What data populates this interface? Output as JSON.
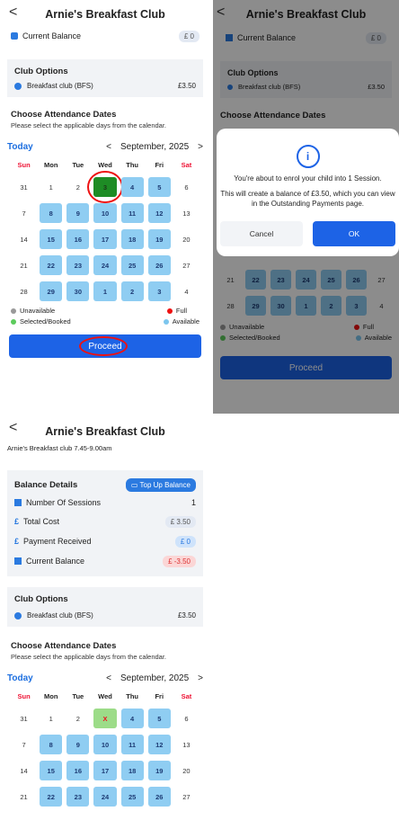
{
  "header": {
    "back_label": "<",
    "title": "Arnie's Breakfast Club"
  },
  "balance": {
    "current_label": "Current Balance",
    "current_value": "£ 0"
  },
  "club_options": {
    "title": "Club Options",
    "item": "Breakfast club (BFS)",
    "price": "£3.50"
  },
  "attendance": {
    "title": "Choose Attendance Dates",
    "hint": "Please select the applicable days from the calendar."
  },
  "calendar": {
    "today_label": "Today",
    "month": "September, 2025",
    "prev": "<",
    "next": ">",
    "days": [
      "Sun",
      "Mon",
      "Tue",
      "Wed",
      "Thu",
      "Fri",
      "Sat"
    ],
    "rows": [
      [
        "31",
        "1",
        "2",
        "3",
        "4",
        "5",
        "6"
      ],
      [
        "7",
        "8",
        "9",
        "10",
        "11",
        "12",
        "13"
      ],
      [
        "14",
        "15",
        "16",
        "17",
        "18",
        "19",
        "20"
      ],
      [
        "21",
        "22",
        "23",
        "24",
        "25",
        "26",
        "27"
      ],
      [
        "28",
        "29",
        "30",
        "1",
        "2",
        "3",
        "4"
      ]
    ]
  },
  "legend": {
    "unavailable": "Unavailable",
    "full": "Full",
    "selected": "Selected/Booked",
    "available": "Available"
  },
  "proceed_label": "Proceed",
  "modal": {
    "text1": "You're about to enrol your child into 1 Session.",
    "text2": "This will create a balance of £3.50, which you can view in the Outstanding Payments page.",
    "cancel": "Cancel",
    "ok": "OK"
  },
  "panel3": {
    "subtitle": "Arnie's Breakfast club 7.45-9.00am",
    "balance_title": "Balance Details",
    "topup": "Top Up Balance",
    "sessions_label": "Number Of Sessions",
    "sessions_value": "1",
    "total_label": "Total Cost",
    "total_value": "£ 3.50",
    "received_label": "Payment Received",
    "received_value": "£ 0",
    "current_label": "Current Balance",
    "current_value": "£ -3.50",
    "marked": "X"
  },
  "colors": {
    "accent": "#1d63e6",
    "available": "#8fcdf2",
    "selected": "#1e8c25",
    "full_bg": "#9cdc88",
    "full_text": "#e11"
  }
}
